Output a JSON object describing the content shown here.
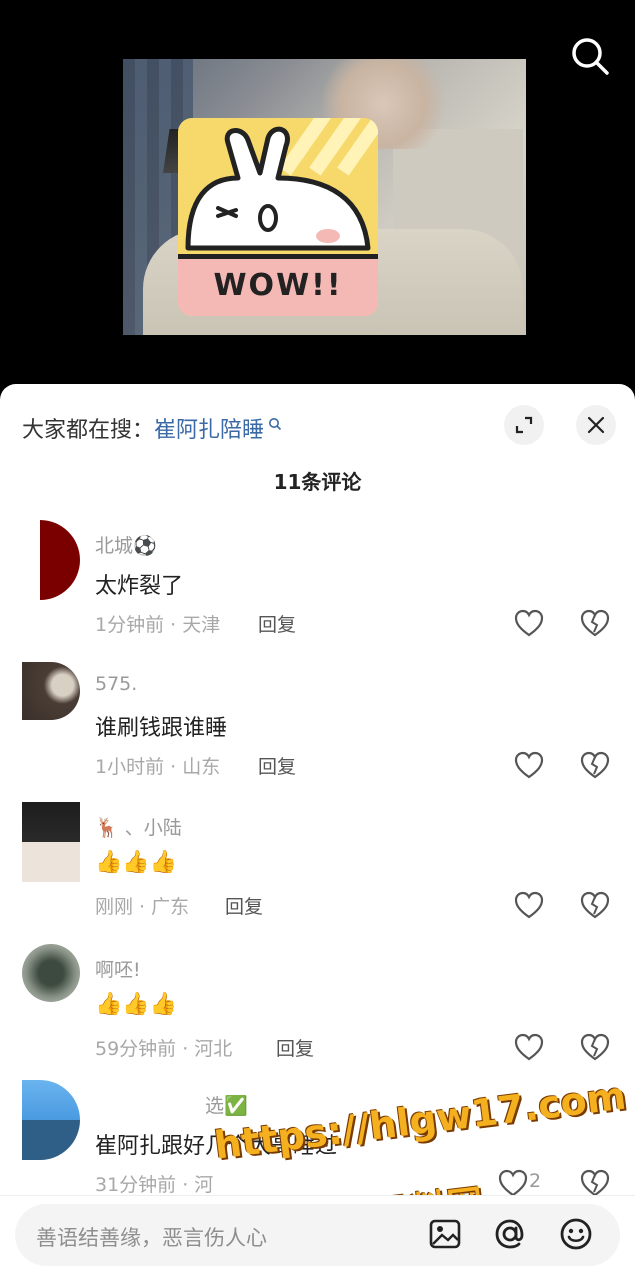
{
  "header": {
    "search_prompt": "大家都在搜：",
    "search_term": "崔阿扎陪睡",
    "comment_count": "11条评论"
  },
  "video": {
    "sticker_text": "WOW!!"
  },
  "comments": [
    {
      "user": "北城⚽",
      "text": "太炸裂了",
      "meta": "1分钟前 · 天津",
      "reply": "回复",
      "likes": ""
    },
    {
      "user": "575.",
      "text": "谁刷钱跟谁睡",
      "meta": "1小时前 · 山东",
      "reply": "回复",
      "likes": ""
    },
    {
      "user": "🦌 、小陆",
      "text": "👍👍👍",
      "meta": "刚刚 · 广东",
      "reply": "回复",
      "likes": ""
    },
    {
      "user": "啊呸!",
      "text": "👍👍👍",
      "meta": "59分钟前 · 河北",
      "reply": "回复",
      "likes": ""
    },
    {
      "user": "选✅",
      "text": "崔阿扎跟好几个大哥睡过",
      "meta": "31分钟前 · 河",
      "reply": "",
      "likes": "2"
    }
  ],
  "watermark": {
    "url": "https://hlgw17.com",
    "name": "黑料网"
  },
  "input": {
    "placeholder": "善语结善缘，恶言伤人心"
  },
  "icons": {
    "search": "search-icon",
    "expand": "expand-icon",
    "close": "close-icon",
    "like": "heart-icon",
    "dislike": "broken-heart-icon",
    "image": "image-icon",
    "mention": "at-icon",
    "emoji": "emoji-icon"
  }
}
